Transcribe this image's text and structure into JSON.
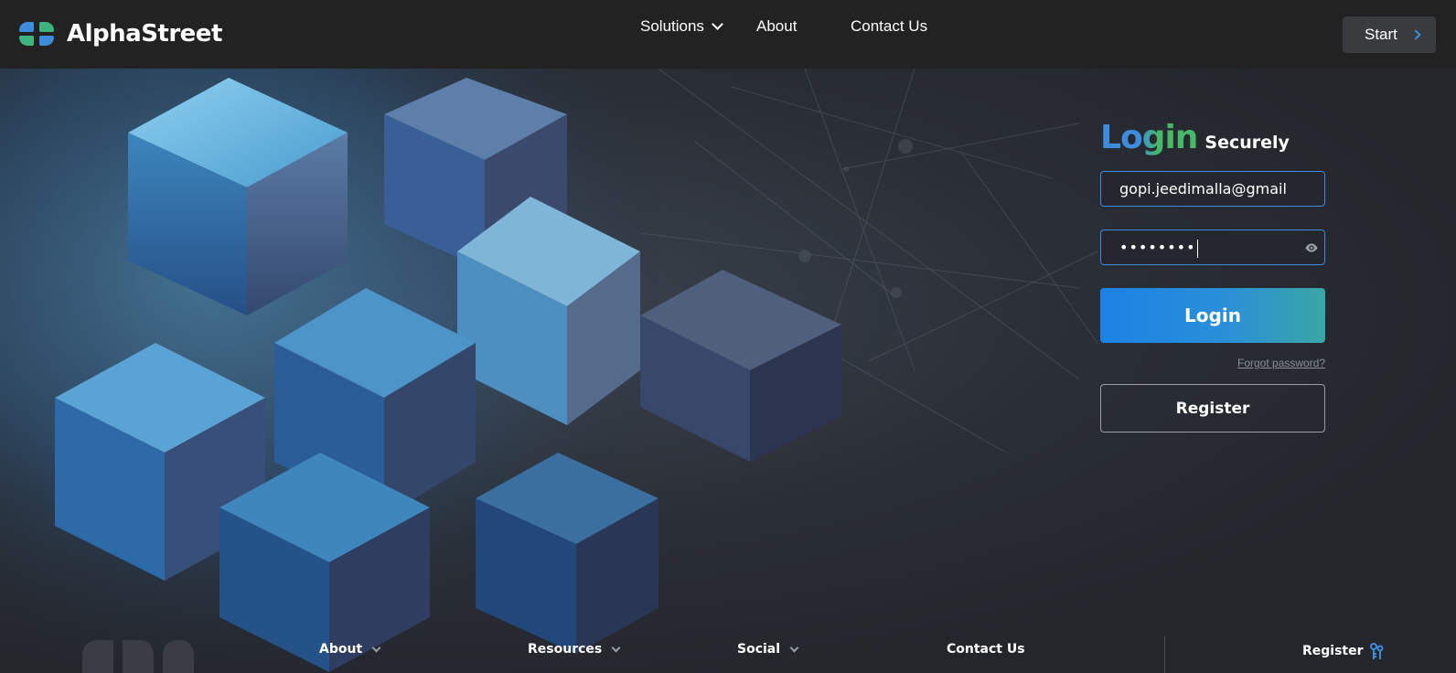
{
  "brand": {
    "name": "AlphaStreet"
  },
  "nav": {
    "solutions": "Solutions",
    "about": "About",
    "contact": "Contact Us"
  },
  "header": {
    "start_label": "Start"
  },
  "login": {
    "title_main": "Login",
    "title_sub": "Securely",
    "email_value": "gopi.jeedimalla@gmail.com",
    "password_mask": "••••••••",
    "login_label": "Login",
    "forgot_label": "Forgot password?",
    "register_label": "Register"
  },
  "footer": {
    "about": "About",
    "resources": "Resources",
    "social": "Social",
    "contact": "Contact Us",
    "register": "Register"
  },
  "colors": {
    "accent_blue": "#3d8ddc",
    "accent_green": "#46b868",
    "header_bg": "#222222"
  },
  "icons": [
    "logo-icon",
    "chevron-down-icon",
    "chevron-right-icon",
    "eye-icon",
    "register-icon"
  ]
}
